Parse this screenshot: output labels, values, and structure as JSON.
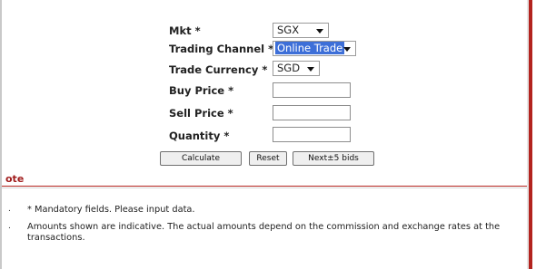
{
  "form": {
    "mkt": {
      "label": "Mkt *",
      "value": "SGX"
    },
    "channel": {
      "label": "Trading Channel *",
      "value": "Online Trade"
    },
    "currency": {
      "label": "Trade Currency *",
      "value": "SGD"
    },
    "buy": {
      "label": "Buy Price  *",
      "value": ""
    },
    "sell": {
      "label": "Sell Price  *",
      "value": ""
    },
    "qty": {
      "label": "Quantity  *",
      "value": ""
    }
  },
  "buttons": {
    "calculate": "Calculate",
    "reset": "Reset",
    "next_bids": "Next±5 bids"
  },
  "note": {
    "title": "ote",
    "items": [
      "* Mandatory fields. Please input data.",
      "Amounts shown are indicative. The actual amounts depend on the commission and exchange rates at the transactions."
    ],
    "bullet": "."
  }
}
